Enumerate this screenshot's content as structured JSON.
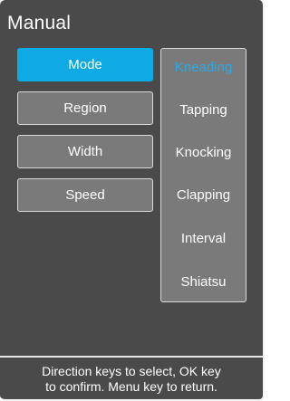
{
  "screen": {
    "title": "Manual"
  },
  "menu": {
    "items": [
      {
        "label": "Mode",
        "selected": true
      },
      {
        "label": "Region",
        "selected": false
      },
      {
        "label": "Width",
        "selected": false
      },
      {
        "label": "Speed",
        "selected": false
      }
    ]
  },
  "options": {
    "items": [
      {
        "label": "Kneading",
        "active": true
      },
      {
        "label": "Tapping",
        "active": false
      },
      {
        "label": "Knocking",
        "active": false
      },
      {
        "label": "Clapping",
        "active": false
      },
      {
        "label": "Interval",
        "active": false
      },
      {
        "label": "Shiatsu",
        "active": false
      }
    ]
  },
  "footer": {
    "help_line1": "Direction keys to select, OK key",
    "help_line2": "to confirm. Menu key to return."
  },
  "colors": {
    "background": "#4a4a4a",
    "button": "#7a7a7a",
    "selected": "#0eaae6",
    "active_text": "#2aa8e6",
    "text": "#ffffff"
  }
}
